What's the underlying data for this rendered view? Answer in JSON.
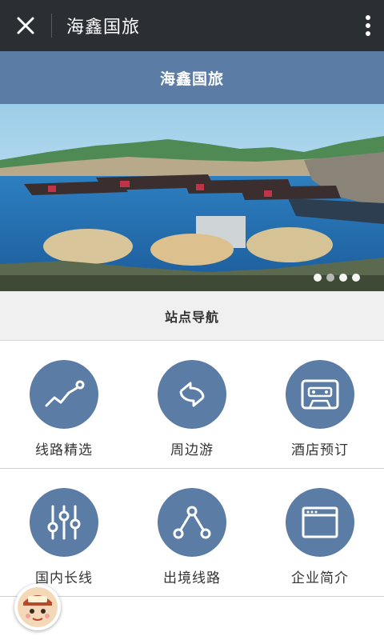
{
  "topbar": {
    "title": "海鑫国旅",
    "close_icon": "close-icon",
    "more_icon": "more-vertical-icon"
  },
  "header": {
    "title": "海鑫国旅"
  },
  "banner": {
    "slides_total": 4,
    "active_slide": 2
  },
  "nav": {
    "title": "站点导航"
  },
  "grid": [
    {
      "label": "线路精选",
      "icon": "trend-line-icon"
    },
    {
      "label": "周边游",
      "icon": "refresh-arrows-icon"
    },
    {
      "label": "酒店预订",
      "icon": "cassette-icon"
    },
    {
      "label": "国内长线",
      "icon": "sliders-icon"
    },
    {
      "label": "出境线路",
      "icon": "route-nodes-icon"
    },
    {
      "label": "企业简介",
      "icon": "browser-window-icon"
    }
  ],
  "colors": {
    "accent": "#5a7ca5",
    "topbar": "#2b2e33"
  }
}
